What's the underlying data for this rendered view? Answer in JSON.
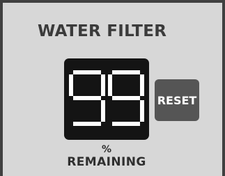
{
  "panel": {
    "title": "WATER FILTER"
  },
  "display": {
    "value": "99",
    "unit": "%",
    "caption": "REMAINING",
    "segment_color": "#ffffff",
    "background_color": "#141414"
  },
  "buttons": {
    "reset_label": "RESET"
  }
}
